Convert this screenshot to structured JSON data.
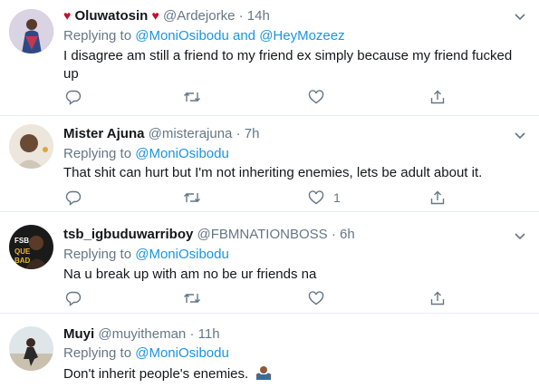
{
  "tweets": [
    {
      "name": "Oluwatosin",
      "handle": "@Ardejorke",
      "separator": "·",
      "time": "14h",
      "replying_prefix": "Replying to",
      "replying_to": "@MoniOsibodu and @HeyMozeez",
      "text": "I disagree am still a friend to my friend ex simply because my friend fucked up",
      "like_count": ""
    },
    {
      "name": "Mister Ajuna",
      "handle": "@misterajuna",
      "separator": "·",
      "time": "7h",
      "replying_prefix": "Replying to",
      "replying_to": "@MoniOsibodu",
      "text": "That shit can hurt but I'm not inheriting enemies, lets be adult about it.",
      "like_count": "1"
    },
    {
      "name": "tsb_igbuduwarriboy",
      "handle": "@FBMNATIONBOSS",
      "separator": "·",
      "time": "6h",
      "replying_prefix": "Replying to",
      "replying_to": "@MoniOsibodu",
      "text": "Na u break up with am no be ur friends na",
      "like_count": ""
    },
    {
      "name": "Muyi",
      "handle": "@muyitheman",
      "separator": "·",
      "time": "11h",
      "replying_prefix": "Replying to",
      "replying_to": "@MoniOsibodu",
      "text": "Don't inherit people's enemies.",
      "like_count": ""
    }
  ],
  "avatar_texts": {
    "tweet3": "FSB QUE BAD"
  },
  "colors": {
    "link": "#1b95e0",
    "muted": "#657786",
    "heart": "#c0122b",
    "divider": "#e6ecf0"
  }
}
